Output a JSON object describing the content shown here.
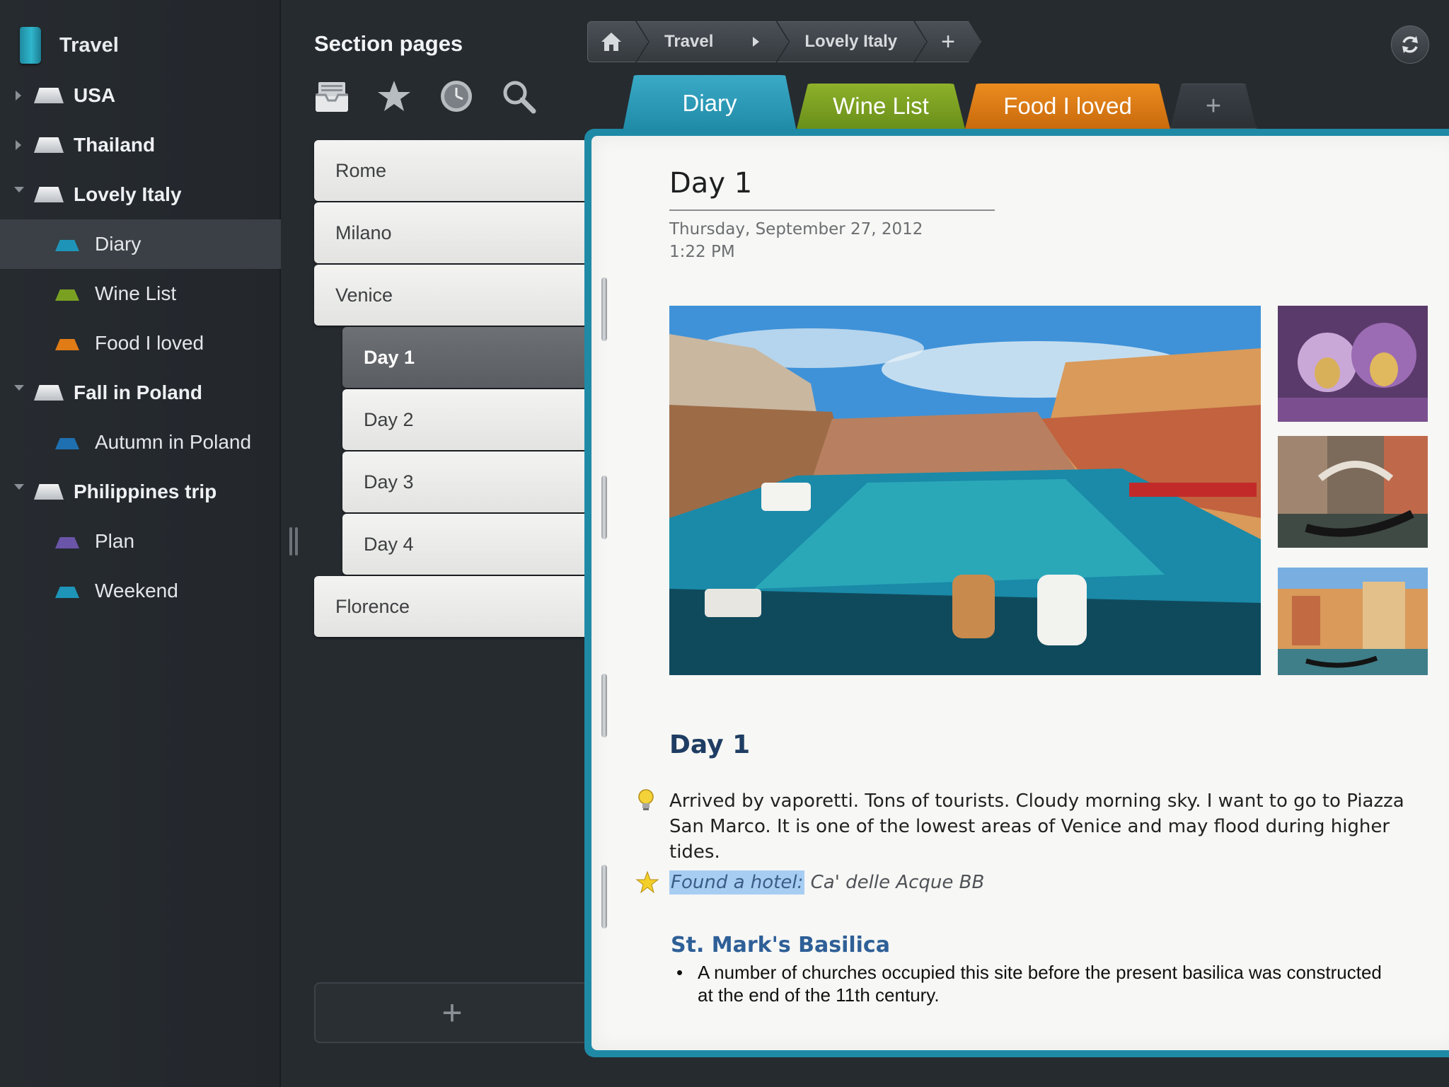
{
  "sidebar": {
    "notebook_title": "Travel",
    "groups": [
      {
        "label": "USA",
        "expanded": false
      },
      {
        "label": "Thailand",
        "expanded": false
      },
      {
        "label": "Lovely Italy",
        "expanded": true
      },
      {
        "label": "Fall in Poland",
        "expanded": true
      },
      {
        "label": "Philippines trip",
        "expanded": true
      }
    ],
    "sections": [
      {
        "label": "Diary",
        "color": "#1e95b8",
        "selected": true
      },
      {
        "label": "Wine List",
        "color": "#7aa022"
      },
      {
        "label": "Food I loved",
        "color": "#e07b15"
      },
      {
        "label": "Autumn in Poland",
        "color": "#1f70b0"
      },
      {
        "label": "Plan",
        "color": "#6a55a8"
      },
      {
        "label": "Weekend",
        "color": "#1e95b8"
      }
    ]
  },
  "pages_panel": {
    "title": "Section pages",
    "tools": [
      "inbox-icon",
      "star-icon",
      "clock-icon",
      "search-icon"
    ],
    "pages": [
      {
        "label": "Rome",
        "level": 0
      },
      {
        "label": "Milano",
        "level": 0
      },
      {
        "label": "Venice",
        "level": 0
      },
      {
        "label": "Day 1",
        "level": 1,
        "active": true
      },
      {
        "label": "Day 2",
        "level": 1
      },
      {
        "label": "Day 3",
        "level": 1
      },
      {
        "label": "Day 4",
        "level": 1
      },
      {
        "label": "Florence",
        "level": 0
      }
    ],
    "add_label": "+"
  },
  "breadcrumb": {
    "items": [
      "Travel",
      "Lovely Italy"
    ],
    "add_label": "+"
  },
  "tabs": {
    "diary": "Diary",
    "wine": "Wine List",
    "food": "Food I loved",
    "add": "+"
  },
  "note": {
    "title": "Day 1",
    "date": "Thursday, September 27, 2012",
    "time": "1:22 PM",
    "heading": "Day 1",
    "paragraph": "Arrived by vaporetti. Tons of tourists. Cloudy morning sky.  I want to go to Piazza San Marco. It is one of the lowest areas of Venice and may flood during higher tides.",
    "hotel_label": "Found a hotel:",
    "hotel_value": "Ca' delle Acque BB",
    "subheading": "St. Mark's Basilica",
    "bullet": "A number of churches occupied this site before the present basilica was constructed at the end of the 11th century."
  },
  "colors": {
    "accent_diary": "#1f8aa6",
    "accent_wine": "#7aa022",
    "accent_food": "#e07b15"
  }
}
